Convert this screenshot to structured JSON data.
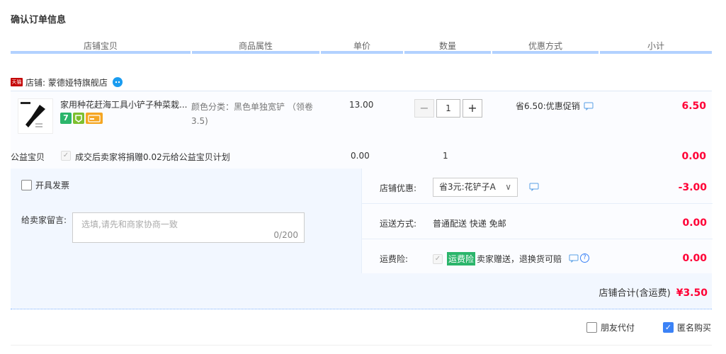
{
  "page_title": "确认订单信息",
  "columns": [
    "店铺宝贝",
    "商品属性",
    "单价",
    "数量",
    "优惠方式",
    "小计"
  ],
  "shop": {
    "badge": "天猫",
    "name": "店铺: 蒙德娅特旗舰店"
  },
  "item": {
    "title": "家用种花赶海工具小铲子种菜栽...",
    "badge_text": "7",
    "attributes": "颜色分类：黑色单独宽铲 （领卷3.5)",
    "unit_price": "13.00",
    "quantity": "1",
    "qty_minus": "−",
    "qty_plus": "+",
    "promotion": "省6.50:优惠促销",
    "subtotal": "6.50"
  },
  "charity": {
    "label": "公益宝贝",
    "check": "✓",
    "text": "成交后卖家将捐赠0.02元给公益宝贝计划",
    "price": "0.00",
    "qty": "1",
    "subtotal": "0.00"
  },
  "invoice": {
    "label": "开具发票"
  },
  "message": {
    "label": "给卖家留言:",
    "placeholder": "选填,请先和商家协商一致",
    "count": "0/200"
  },
  "shop_discount": {
    "label": "店铺优惠:",
    "selected": "省3元:花铲子A",
    "caret": "∨",
    "value": "-3.00"
  },
  "shipping": {
    "label": "运送方式:",
    "text": "普通配送 快递 免邮",
    "value": "0.00"
  },
  "insurance": {
    "label": "运费险:",
    "check": "✓",
    "badge": "运费险",
    "text": "卖家赠送，退换货可赔",
    "help": "?",
    "value": "0.00"
  },
  "total": {
    "label": "店铺合计(含运费)",
    "value": "¥3.50"
  },
  "options": {
    "friend_pay": "朋友代付",
    "anonymous": "匿名购买",
    "anonymous_check": "✓"
  },
  "colors": {
    "accent_red": "#ff0036",
    "header_line": "#b2d1ff",
    "panel_bg": "#f2f7ff",
    "check_blue": "#3b82f6",
    "tmall_red": "#c40000"
  }
}
